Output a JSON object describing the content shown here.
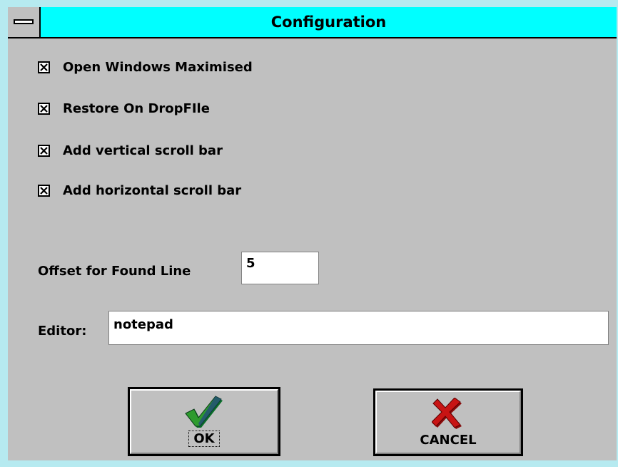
{
  "window": {
    "title": "Configuration"
  },
  "options": [
    {
      "label": "Open Windows Maximised",
      "checked": true
    },
    {
      "label": "Restore On DropFIle",
      "checked": true
    },
    {
      "label": "Add vertical scroll bar",
      "checked": true
    },
    {
      "label": "Add horizontal scroll bar",
      "checked": true
    }
  ],
  "offset": {
    "label": "Offset for Found Line",
    "value": "5"
  },
  "editor": {
    "label": "Editor:",
    "value": "notepad"
  },
  "buttons": {
    "ok_label": "OK",
    "ok_icon": "checkmark-icon",
    "cancel_label": "CANCEL",
    "cancel_icon": "x-mark-icon"
  },
  "colors": {
    "titlebar": "#00ffff",
    "frame": "#b6eaf0",
    "face": "#c0c0c0",
    "ok_check": "#2e9b2e",
    "cancel_x": "#c81414"
  }
}
